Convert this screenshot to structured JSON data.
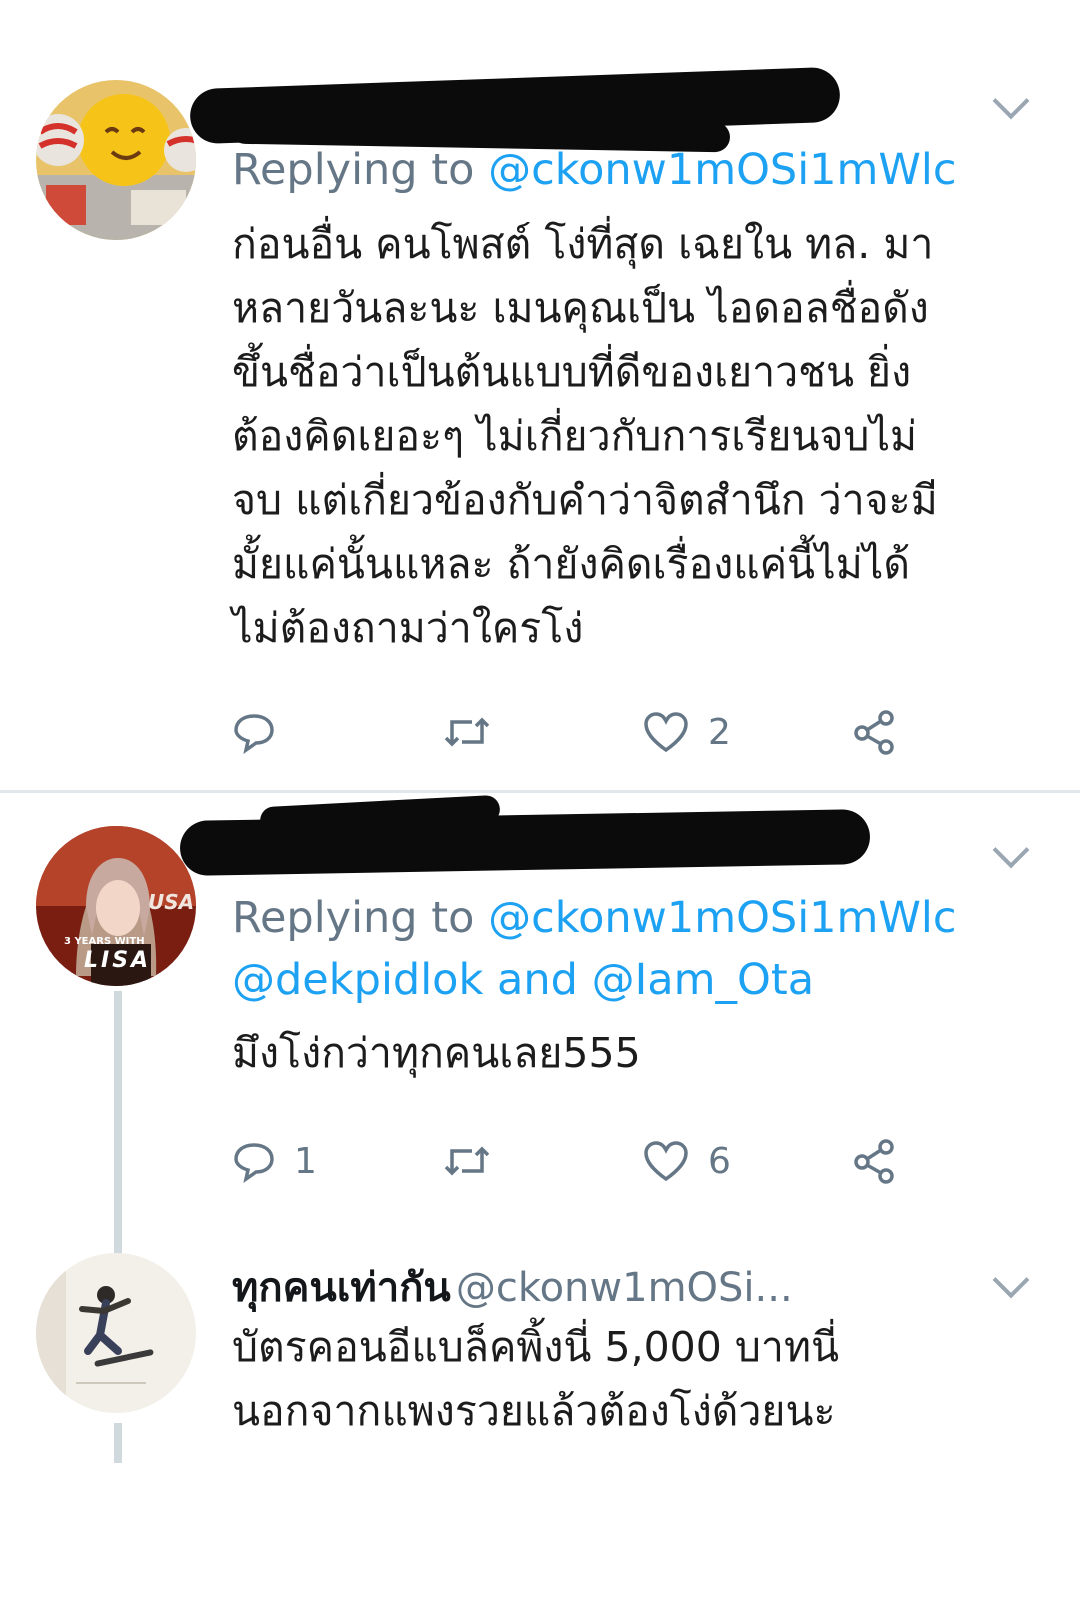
{
  "tweets": [
    {
      "replying_prefix": "Replying to",
      "replying_handles": "@ckonw1mOSi1mWlc",
      "body_lines": [
        "ก่อนอื่น คนโพสต์ โง่ที่สุด เฉยใน ทล. มา",
        "หลายวันละนะ เมนคุณเป็น ไอดอลชื่อดัง",
        "ขึ้นชื่อว่าเป็นต้นแบบที่ดีของเยาวชน ยิ่ง",
        "ต้องคิดเยอะๆ ไม่เกี่ยวกับการเรียนจบไม่",
        "จบ แต่เกี่ยวข้องกับคำว่าจิตสำนึก ว่าจะมี",
        "มั้ยแค่นั้นแหละ  ถ้ายังคิดเรื่องแค่นี้ไม่ได้",
        "ไม่ต้องถามว่าใครโง่"
      ],
      "reply_count": "",
      "like_count": "2",
      "icons": [
        "reply-icon",
        "retweet-icon",
        "heart-icon",
        "share-icon"
      ]
    },
    {
      "replying_prefix": "Replying to",
      "replying_handles": "@ckonw1mOSi1mWlc",
      "replying_line2": "@dekpidlok and @Iam_Ota",
      "body_lines": [
        "มึงโง่กว่าทุกคนเลย555"
      ],
      "reply_count": "1",
      "like_count": "6",
      "avatar_text_top": "3 YEARS WITH",
      "avatar_text_bottom": "LISA",
      "avatar_text_side": "USA"
    },
    {
      "display_name": "ทุกคนเท่ากัน",
      "handle": "@ckonw1mOSi...",
      "body_lines": [
        "บัตรคอนอีแบล็คพิ้งนี่ 5,000 บาทนี่",
        "นอกจากแพงรวยแล้วต้องโง่ด้วยนะ"
      ]
    }
  ],
  "colors": {
    "link": "#1da1f2",
    "muted": "#657786",
    "redaction": "#0b0b0b"
  }
}
